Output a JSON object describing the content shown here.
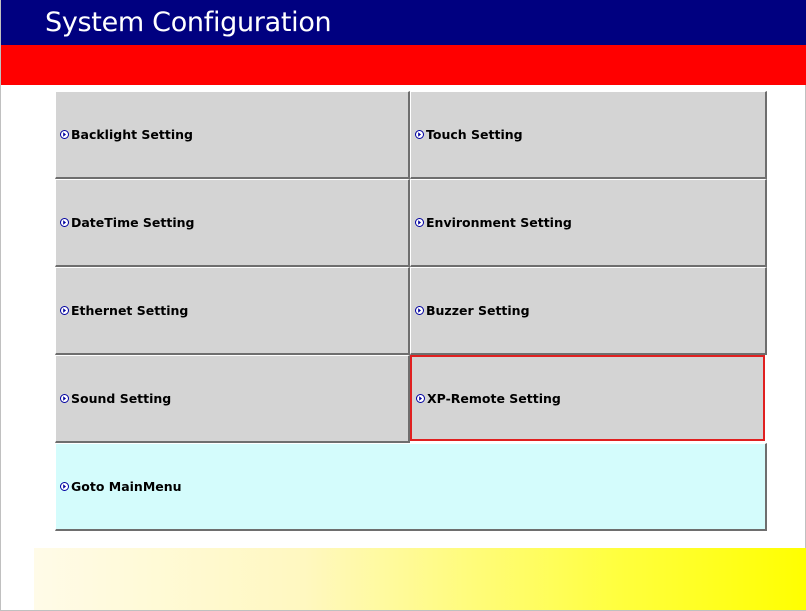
{
  "header": {
    "title": "System Configuration"
  },
  "colors": {
    "title_bar": "#000080",
    "red_band": "#ff0000",
    "button_face": "#d4d4d4",
    "main_menu_face": "#d4fcfc",
    "selection_outline": "#e02020",
    "arrow_icon": "#0000a0"
  },
  "menu": {
    "items": [
      {
        "label": "Backlight Setting",
        "icon": "circle-arrow-right-icon"
      },
      {
        "label": "Touch Setting",
        "icon": "circle-arrow-right-icon"
      },
      {
        "label": "DateTime Setting",
        "icon": "circle-arrow-right-icon"
      },
      {
        "label": "Environment Setting",
        "icon": "circle-arrow-right-icon"
      },
      {
        "label": "Ethernet Setting",
        "icon": "circle-arrow-right-icon"
      },
      {
        "label": "Buzzer Setting",
        "icon": "circle-arrow-right-icon"
      },
      {
        "label": "Sound Setting",
        "icon": "circle-arrow-right-icon"
      },
      {
        "label": "XP-Remote Setting",
        "icon": "circle-arrow-right-icon",
        "selected": true
      }
    ],
    "main_menu": {
      "label": "Goto MainMenu",
      "icon": "circle-arrow-right-icon"
    }
  }
}
